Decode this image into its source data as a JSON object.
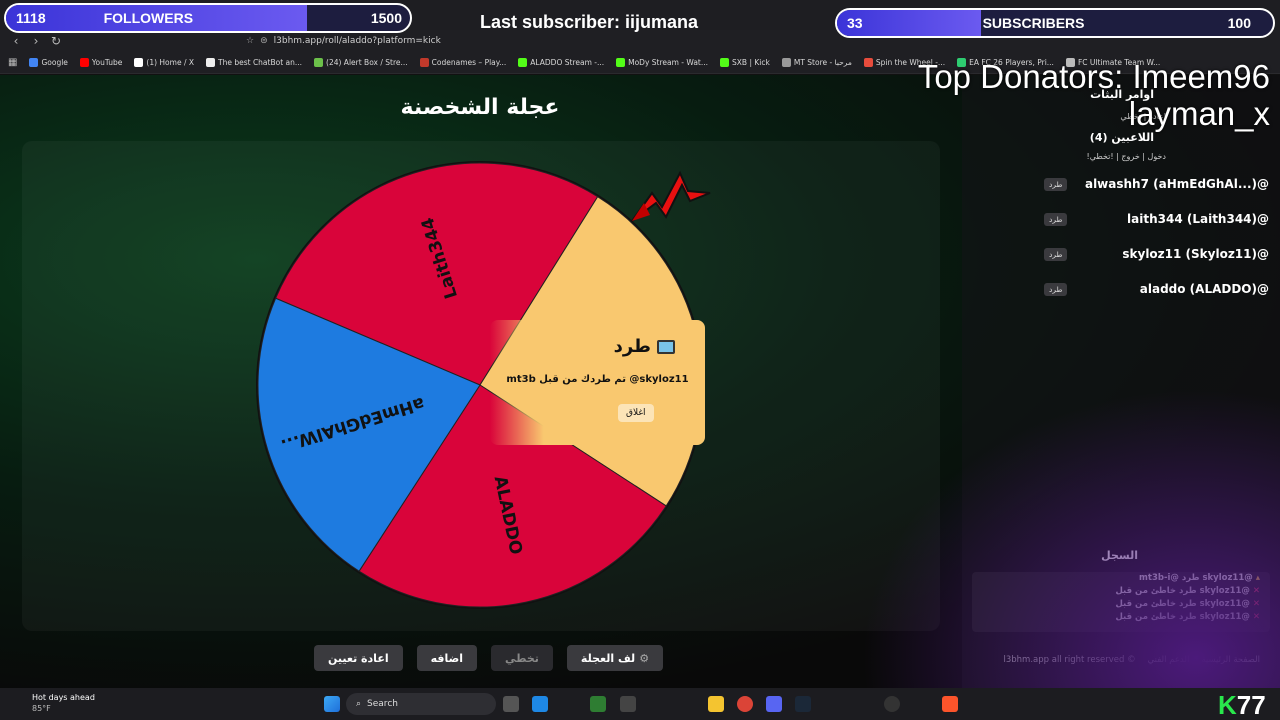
{
  "overlay": {
    "followers": {
      "label": "FOLLOWERS",
      "current": "1118",
      "goal": "1500",
      "progress": 0.745
    },
    "last_subscriber": "Last subscriber: iijumana",
    "subscribers": {
      "label": "SUBSCRIBERS",
      "current": "33",
      "goal": "100",
      "progress": 0.33
    },
    "top_donators_lines": [
      "Top Donators: Imeem96",
      "layman_x"
    ]
  },
  "browser": {
    "url": "l3bhm.app/roll/aladdo?platform=kick",
    "bookmarks": [
      {
        "label": "Google",
        "color": "#4285f4"
      },
      {
        "label": "YouTube",
        "color": "#ff0000"
      },
      {
        "label": "(1) Home / X",
        "color": "#ffffff"
      },
      {
        "label": "The best ChatBot an...",
        "color": "#eeeeee"
      },
      {
        "label": "(24) Alert Box / Stre...",
        "color": "#6cc04a"
      },
      {
        "label": "Codenames – Play...",
        "color": "#c0392b"
      },
      {
        "label": "ALADDO Stream -...",
        "color": "#53fc18"
      },
      {
        "label": "MoDy Stream - Wat...",
        "color": "#53fc18"
      },
      {
        "label": "SXB | Kick",
        "color": "#53fc18"
      },
      {
        "label": "MT Store - مرحبا",
        "color": "#999999"
      },
      {
        "label": "Spin the Wheel -...",
        "color": "#e74c3c"
      },
      {
        "label": "EA FC 26 Players, Pri...",
        "color": "#2ecc71"
      },
      {
        "label": "FC Ultimate Team W...",
        "color": "#bbbbbb"
      }
    ]
  },
  "page": {
    "title": "عجلة الشخصنة",
    "wheel": {
      "segments": [
        {
          "label": "Laith344",
          "color": "#d9043a"
        },
        {
          "label": "",
          "color": "#f9c86f"
        },
        {
          "label": "ALADDO",
          "color": "#d9043a"
        },
        {
          "label": "aHmEdGhAlW...",
          "color": "#1e7be0"
        }
      ]
    },
    "toast": {
      "title": "طرد",
      "message": "mt3b تم طردك من قبل @skyloz11",
      "close_label": "اغلاق"
    },
    "controls": {
      "spin": "لف العجلة",
      "skip": "تخطي",
      "add": "اضافه",
      "reset": "اعادة تعيين"
    }
  },
  "sidebar": {
    "commands_title": "اوامر البثات",
    "commands_line": "اعاده | تخطي",
    "players_title": "اللاعبين (4)",
    "players_hint": "!دخول | خروج | !تخطي",
    "players": [
      {
        "name": "alwashh7 (aHmEdGhAl...)@",
        "kick": "طرد"
      },
      {
        "name": "laith344 (Laith344)@",
        "kick": "طرد"
      },
      {
        "name": "skyloz11 (Skyloz11)@",
        "kick": "طرد"
      },
      {
        "name": "aladdo (ALADDO)@",
        "kick": "طرد"
      }
    ],
    "log_title": "السجل",
    "log": [
      "mt3b-i@ طرد skyloz11@",
      "طرد خاطئ من قبل skyloz11@",
      "طرد خاطئ من قبل skyloz11@",
      "طرد خاطئ من قبل skyloz11@"
    ],
    "footer": {
      "home": "الصفحة الرئيسية",
      "support": "الدعم الفني",
      "rights": "l3bhm.app all right reserved ©"
    }
  },
  "taskbar": {
    "weather_title": "Hot days ahead",
    "weather_temp": "85°F",
    "search": "Search",
    "badge": "77"
  }
}
